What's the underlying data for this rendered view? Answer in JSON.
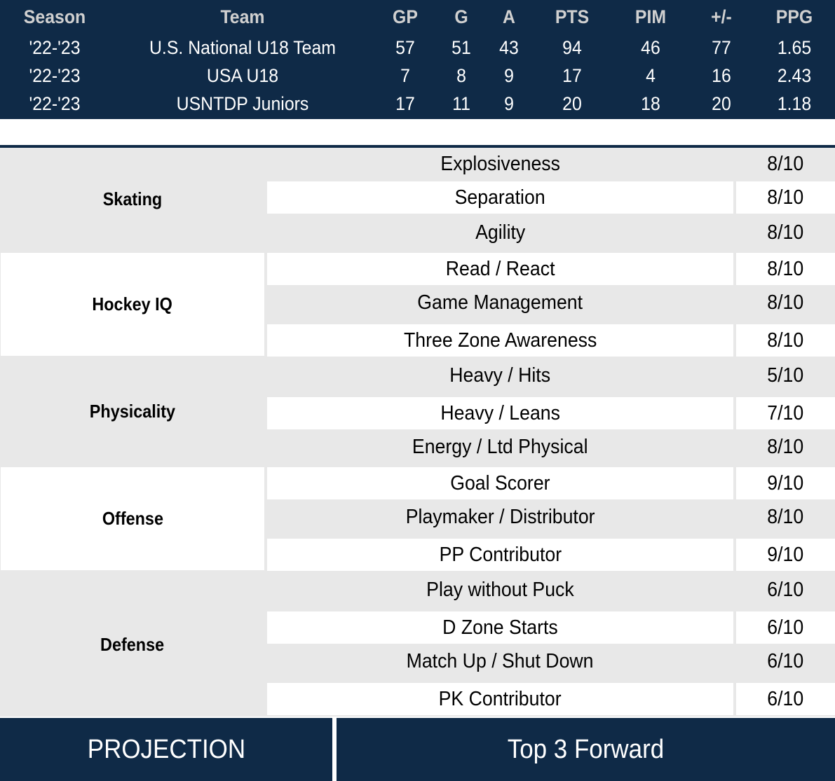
{
  "stats_table": {
    "headers": {
      "season": "Season",
      "team": "Team",
      "gp": "GP",
      "g": "G",
      "a": "A",
      "pts": "PTS",
      "pim": "PIM",
      "plus_minus": "+/-",
      "ppg": "PPG"
    },
    "rows": [
      {
        "season": "'22-'23",
        "team": "U.S. National U18 Team",
        "gp": "57",
        "g": "51",
        "a": "43",
        "pts": "94",
        "pim": "46",
        "plus_minus": "77",
        "ppg": "1.65"
      },
      {
        "season": "'22-'23",
        "team": "USA U18",
        "gp": "7",
        "g": "8",
        "a": "9",
        "pts": "17",
        "pim": "4",
        "plus_minus": "16",
        "ppg": "2.43"
      },
      {
        "season": "'22-'23",
        "team": "USNTDP Juniors",
        "gp": "17",
        "g": "11",
        "a": "9",
        "pts": "20",
        "pim": "18",
        "plus_minus": "20",
        "ppg": "1.18"
      }
    ]
  },
  "ratings": [
    {
      "category": "Skating",
      "skills": [
        {
          "name": "Explosiveness",
          "score": "8/10"
        },
        {
          "name": "Separation",
          "score": "8/10"
        },
        {
          "name": "Agility",
          "score": "8/10"
        }
      ]
    },
    {
      "category": "Hockey IQ",
      "skills": [
        {
          "name": "Read / React",
          "score": "8/10"
        },
        {
          "name": "Game Management",
          "score": "8/10"
        },
        {
          "name": "Three Zone Awareness",
          "score": "8/10"
        }
      ]
    },
    {
      "category": "Physicality",
      "skills": [
        {
          "name": "Heavy / Hits",
          "score": "5/10"
        },
        {
          "name": "Heavy / Leans",
          "score": "7/10"
        },
        {
          "name": "Energy / Ltd Physical",
          "score": "8/10"
        }
      ]
    },
    {
      "category": "Offense",
      "skills": [
        {
          "name": "Goal Scorer",
          "score": "9/10"
        },
        {
          "name": "Playmaker / Distributor",
          "score": "8/10"
        },
        {
          "name": "PP Contributor",
          "score": "9/10"
        }
      ]
    },
    {
      "category": "Defense",
      "skills": [
        {
          "name": "Play without Puck",
          "score": "6/10"
        },
        {
          "name": "D Zone Starts",
          "score": "6/10"
        },
        {
          "name": "Match Up / Shut Down",
          "score": "6/10"
        },
        {
          "name": "PK Contributor",
          "score": "6/10"
        }
      ]
    }
  ],
  "projection": {
    "label": "PROJECTION",
    "value": "Top 3 Forward"
  },
  "colors": {
    "navy": "#0f2a47",
    "row_grey": "#e8e8e8",
    "row_white": "#ffffff",
    "header_text": "#d0d0d0"
  }
}
